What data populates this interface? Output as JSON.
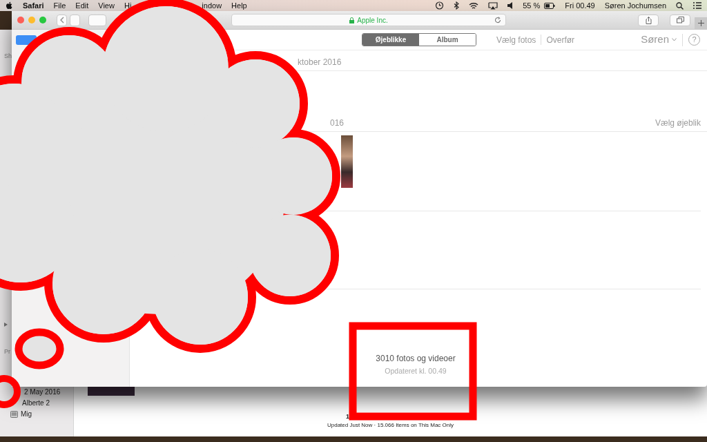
{
  "menubar": {
    "app": "Safari",
    "menus": [
      "File",
      "Edit",
      "View",
      "Hi",
      "indow",
      "Help"
    ],
    "battery": "55 %",
    "clock": "Fri 00.49",
    "user": "Søren Jochumsen"
  },
  "browser": {
    "address": "Apple Inc."
  },
  "photos_web": {
    "segments": [
      {
        "label": "Øjeblikke",
        "selected": true
      },
      {
        "label": "Album",
        "selected": false
      }
    ],
    "actions": [
      "Vælg fotos",
      "Overfør"
    ],
    "account": "Søren",
    "help": "?",
    "sections": [
      {
        "title": "ktober 2016",
        "has_photo": false
      },
      {
        "title": "016",
        "action": "Vælg øjeblik",
        "has_photo": true
      }
    ],
    "footer": {
      "count": "3010 fotos og videoer",
      "updated": "Opdateret kl. 00.49"
    }
  },
  "photos_app": {
    "sidebar_headings": [
      "Sh",
      "Pr"
    ],
    "sidebar_items": [
      {
        "label": "2 May 2016",
        "kind": "album"
      },
      {
        "label": "Alberte 2",
        "kind": "album"
      },
      {
        "label": "Mig",
        "kind": "person-album"
      }
    ],
    "status_title": "1",
    "status": "Updated Just Now · 15.066 Items on This Mac Only"
  }
}
